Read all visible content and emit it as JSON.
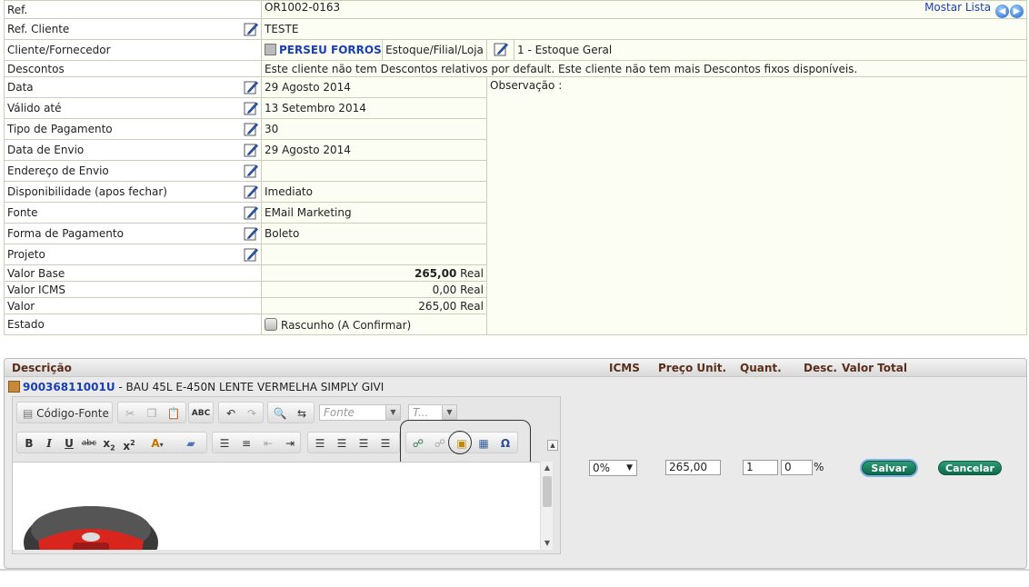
{
  "nav": {
    "show_list": "Mostar Lista"
  },
  "rows": {
    "ref": {
      "label": "Ref.",
      "value": "OR1002-0163"
    },
    "ref_cliente": {
      "label": "Ref. Cliente",
      "value": "TESTE"
    },
    "cliente": {
      "label": "Cliente/Fornecedor",
      "value": "PERSEU FORROS",
      "stock_label": "Estoque/Filial/Loja",
      "stock_value": "1 - Estoque Geral"
    },
    "descontos": {
      "label": "Descontos",
      "value": "Este cliente não tem Descontos relativos por default. Este cliente não tem mais Descontos fixos disponíveis."
    },
    "data": {
      "label": "Data",
      "value": "29 Agosto 2014"
    },
    "valido": {
      "label": "Válido até",
      "value": "13 Setembro 2014"
    },
    "tipo_pag": {
      "label": "Tipo de Pagamento",
      "value": "30"
    },
    "data_envio": {
      "label": "Data de Envio",
      "value": "29 Agosto 2014"
    },
    "endereco": {
      "label": "Endereço de Envio",
      "value": ""
    },
    "disponibilidade": {
      "label": "Disponibilidade (apos fechar)",
      "value": "Imediato"
    },
    "fonte": {
      "label": "Fonte",
      "value": "EMail Marketing"
    },
    "forma_pag": {
      "label": "Forma de Pagamento",
      "value": "Boleto"
    },
    "projeto": {
      "label": "Projeto",
      "value": ""
    },
    "valor_base": {
      "label": "Valor Base",
      "value": "265,00",
      "currency": "Real"
    },
    "valor_icms": {
      "label": "Valor ICMS",
      "value": "0,00",
      "currency": "Real"
    },
    "valor": {
      "label": "Valor",
      "value": "265,00",
      "currency": "Real"
    },
    "estado": {
      "label": "Estado",
      "value": "Rascunho (A Confirmar)"
    },
    "observacao": {
      "label": "Observação :"
    }
  },
  "lines_header": {
    "descricao": "Descrição",
    "icms": "ICMS",
    "preco": "Preço Unit.",
    "quant": "Quant.",
    "desc": "Desc.",
    "total": "Valor Total"
  },
  "product": {
    "code": "90036811001U",
    "description": " - BAU 45L E-450N LENTE VERMELHA SIMPLY GIVI"
  },
  "editor": {
    "source_label": "Código-Fonte",
    "font_placeholder": "Fonte",
    "size_placeholder": "T..."
  },
  "line_edit": {
    "icms": "0%",
    "price": "265,00",
    "qty": "1",
    "discount": "0",
    "percent": "%",
    "save": "Salvar",
    "cancel": "Cancelar"
  },
  "colors": {
    "accent": "#0c6a4c",
    "link": "#1a3fb5",
    "header_text": "#5a2e1b"
  }
}
